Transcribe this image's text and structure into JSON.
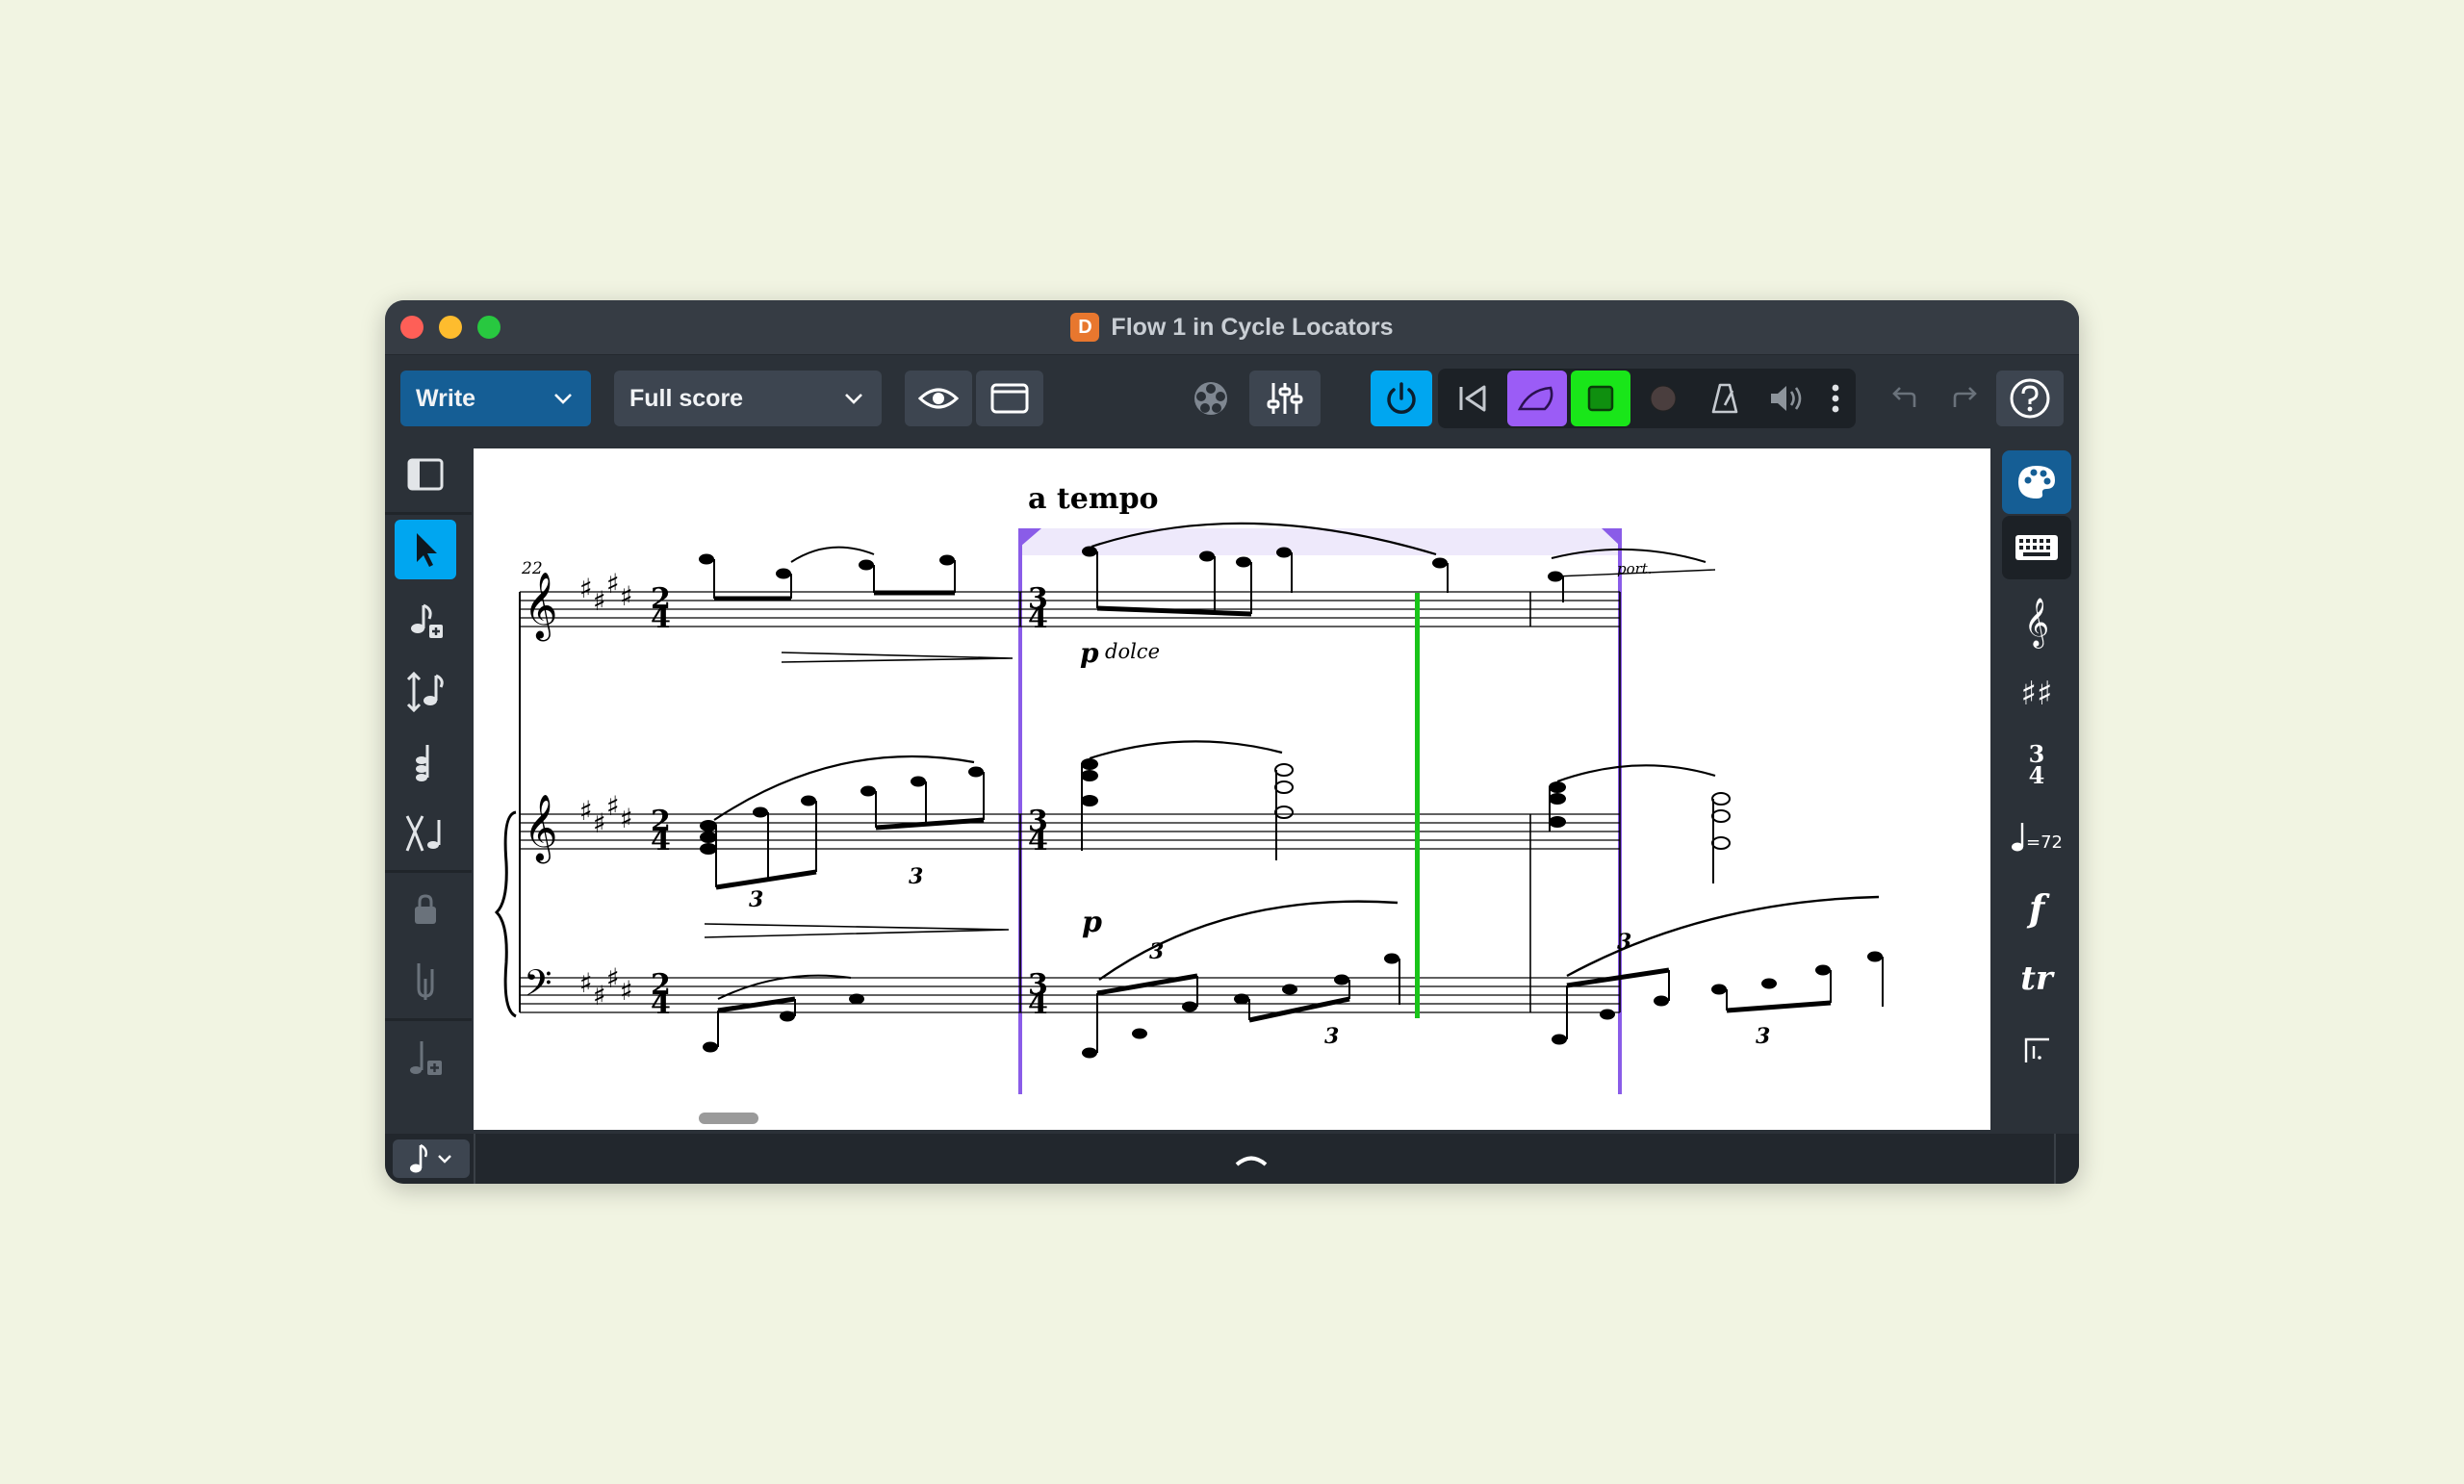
{
  "window": {
    "title": "Flow 1 in Cycle Locators",
    "app_icon": "dorico-app-icon"
  },
  "toolbar": {
    "mode": "Write",
    "layout": "Full score",
    "view_options_icon": "eye-icon",
    "window_icon": "window-layout-icon",
    "video_icon": "film-reel-icon",
    "mixer_icon": "mixer-sliders-icon",
    "transport": {
      "activate_icon": "power-icon",
      "rewind_icon": "rewind-to-start-icon",
      "cycle_icon": "cycle-shape-icon",
      "play_icon": "play-stop-icon",
      "record_icon": "record-icon",
      "metronome_icon": "metronome-icon",
      "volume_icon": "speaker-icon",
      "more_icon": "more-vertical-icon"
    },
    "undo_icon": "undo-icon",
    "redo_icon": "redo-icon",
    "help_icon": "help-icon",
    "colors": {
      "accent_blue": "#00a6f0",
      "cycle_purple": "#9b5cf6",
      "play_green": "#19e619"
    }
  },
  "left_toolbox": {
    "items": [
      "left-panel-icon",
      "select-arrow-icon",
      "note-input-icon",
      "move-notes-icon",
      "insert-chord-icon",
      "split-voice-icon",
      "lock-icon",
      "clip-icon",
      "add-note-icon"
    ]
  },
  "score": {
    "tempo_text": "a tempo",
    "measure_number": "22",
    "dynamic_p1": "p",
    "dolce": "dolce",
    "dynamic_p2": "p",
    "port": "port.",
    "triplet": "3",
    "time_sig_first": {
      "top": "2",
      "bottom": "4"
    },
    "time_sig_second": {
      "top": "3",
      "bottom": "4"
    },
    "colors": {
      "cycle_locator": "#8a5ce8",
      "playhead": "#19c419"
    }
  },
  "right_panel": {
    "items": [
      "palette-icon",
      "keyboard-icon",
      "treble-clef-icon",
      "key-signature-icon",
      "time-signature-icon",
      "tempo-icon",
      "dynamics-icon",
      "trill-icon",
      "repeat-ending-icon"
    ],
    "time_sig_top": "3",
    "time_sig_bottom": "4",
    "tempo_text": "=72",
    "dynamic_text": "f",
    "trill_text": "tr"
  },
  "bottom": {
    "note_icon": "eighth-note-icon",
    "expand_icon": "chevron-up-icon"
  }
}
